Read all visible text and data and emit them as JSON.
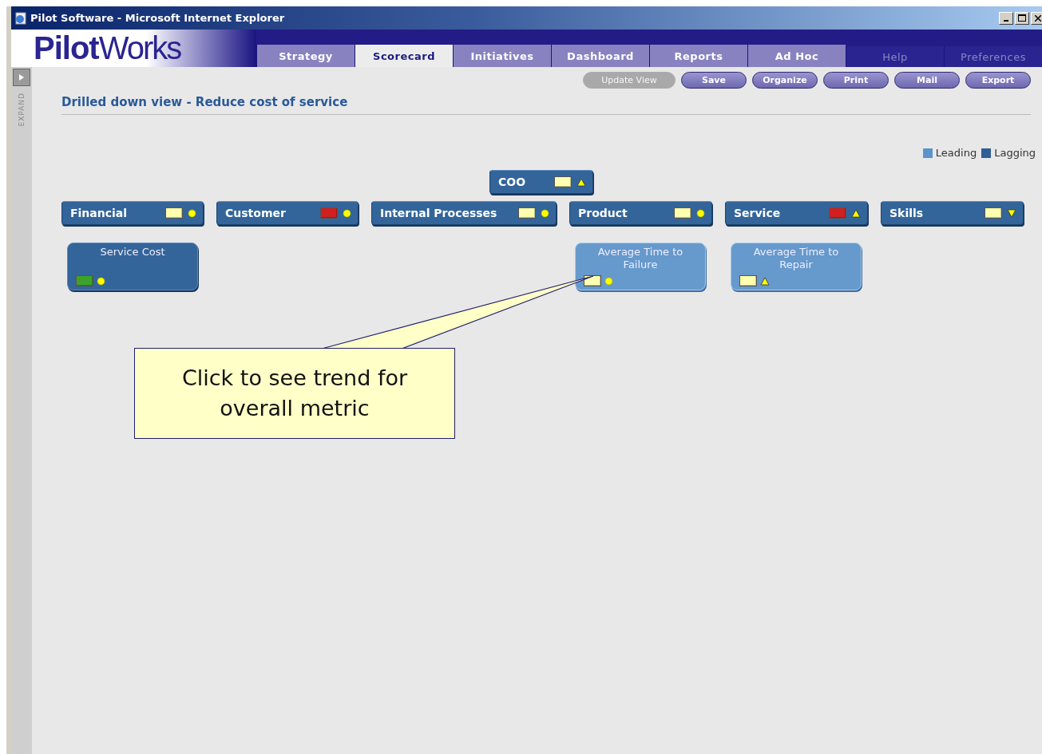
{
  "window": {
    "title": "Pilot Software - Microsoft Internet Explorer"
  },
  "logo": {
    "bold": "Pilot",
    "light": "Works"
  },
  "tabs": [
    {
      "label": "Strategy",
      "selected": false,
      "kind": "main"
    },
    {
      "label": "Scorecard",
      "selected": true,
      "kind": "main"
    },
    {
      "label": "Initiatives",
      "selected": false,
      "kind": "main"
    },
    {
      "label": "Dashboard",
      "selected": false,
      "kind": "main"
    },
    {
      "label": "Reports",
      "selected": false,
      "kind": "main"
    },
    {
      "label": "Ad Hoc",
      "selected": false,
      "kind": "main"
    },
    {
      "label": "Help",
      "selected": false,
      "kind": "utility"
    },
    {
      "label": "Preferences",
      "selected": false,
      "kind": "utility"
    }
  ],
  "toolbar": [
    {
      "label": "Update View",
      "disabled": true
    },
    {
      "label": "Save",
      "disabled": false
    },
    {
      "label": "Organize",
      "disabled": false
    },
    {
      "label": "Print",
      "disabled": false
    },
    {
      "label": "Mail",
      "disabled": false
    },
    {
      "label": "Export",
      "disabled": false
    }
  ],
  "sidebar": {
    "label": "EXPAND"
  },
  "heading": "Drilled down view - Reduce cost of service",
  "legend": [
    {
      "label": "Leading",
      "color": "#5b93cc"
    },
    {
      "label": "Lagging",
      "color": "#2f5f95"
    }
  ],
  "root": {
    "name": "COO",
    "color": "#ffffb0",
    "trend": {
      "kind": "up"
    }
  },
  "perspectives": [
    {
      "name": "Financial",
      "color": "#ffffb0",
      "trend": {
        "kind": "steady"
      },
      "metrics": [
        {
          "name": "Service Cost",
          "kind": "lagging",
          "color": "#3da22a",
          "trend": {
            "kind": "steady"
          }
        }
      ]
    },
    {
      "name": "Customer",
      "color": "#d02020",
      "trend": {
        "kind": "steady"
      }
    },
    {
      "name": "Internal Processes",
      "color": "#ffffb0",
      "trend": {
        "kind": "steady"
      }
    },
    {
      "name": "Product",
      "color": "#ffffb0",
      "trend": {
        "kind": "steady"
      },
      "metrics": [
        {
          "name": "Average Time to Failure",
          "kind": "leading",
          "color": "#ffffb0",
          "trend": {
            "kind": "steady"
          }
        }
      ]
    },
    {
      "name": "Service",
      "color": "#d02020",
      "trend": {
        "kind": "up"
      },
      "metrics": [
        {
          "name": "Average Time to Repair",
          "kind": "leading",
          "color": "#ffffb0",
          "trend": {
            "kind": "up"
          }
        }
      ]
    },
    {
      "name": "Skills",
      "color": "#ffffb0",
      "trend": {
        "kind": "down"
      }
    }
  ],
  "callout": {
    "text": "Click to see trend for overall metric"
  }
}
